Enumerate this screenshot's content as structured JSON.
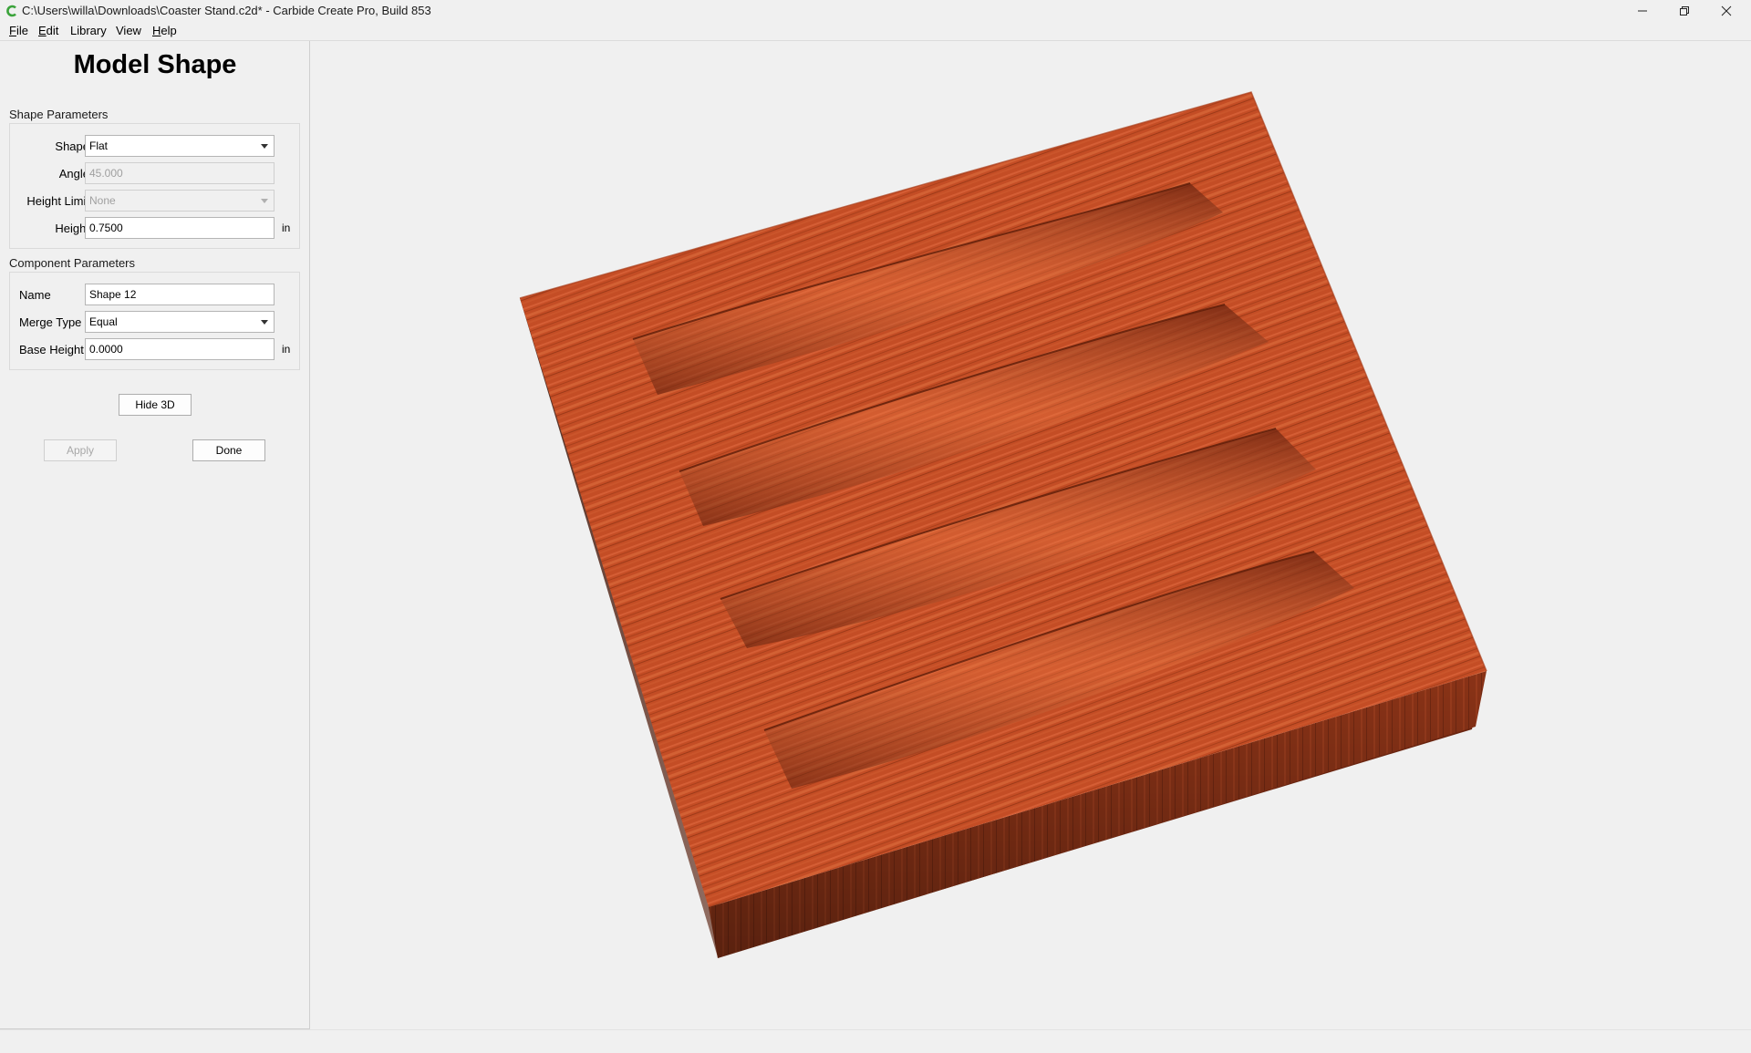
{
  "window": {
    "title": "C:\\Users\\willa\\Downloads\\Coaster Stand.c2d* - Carbide Create Pro, Build 853",
    "icon": "carbide-c-icon",
    "controls": [
      "minimize-icon",
      "restore-icon",
      "close-icon"
    ]
  },
  "menu": {
    "items": [
      {
        "label": "File",
        "mnemonic": "F",
        "rest": "ile"
      },
      {
        "label": "Edit",
        "mnemonic": "E",
        "rest": "dit"
      },
      {
        "label": "Library",
        "mnemonic": "",
        "rest": "Library"
      },
      {
        "label": "View",
        "mnemonic": "",
        "rest": "View"
      },
      {
        "label": "Help",
        "mnemonic": "H",
        "rest": "elp"
      }
    ]
  },
  "panel": {
    "title": "Model Shape",
    "shape_parameters": {
      "label": "Shape Parameters",
      "shape": {
        "label": "Shape",
        "value": "Flat"
      },
      "angle": {
        "label": "Angle",
        "value": "45.000"
      },
      "height_limit": {
        "label": "Height Limit",
        "value": "None"
      },
      "height": {
        "label": "Height",
        "value": "0.7500",
        "unit": "in"
      }
    },
    "component_parameters": {
      "label": "Component Parameters",
      "name": {
        "label": "Name",
        "value": "Shape 12"
      },
      "merge_type": {
        "label": "Merge Type",
        "value": "Equal"
      },
      "base_height": {
        "label": "Base Height",
        "value": "0.0000",
        "unit": "in"
      }
    },
    "buttons": {
      "hide_3d": "Hide 3D",
      "apply": "Apply",
      "done": "Done"
    }
  },
  "viewport": {
    "colors": {
      "wood_light": "#d2572e",
      "wood_mid": "#b8431f",
      "wood_dark": "#7a2a12"
    }
  }
}
